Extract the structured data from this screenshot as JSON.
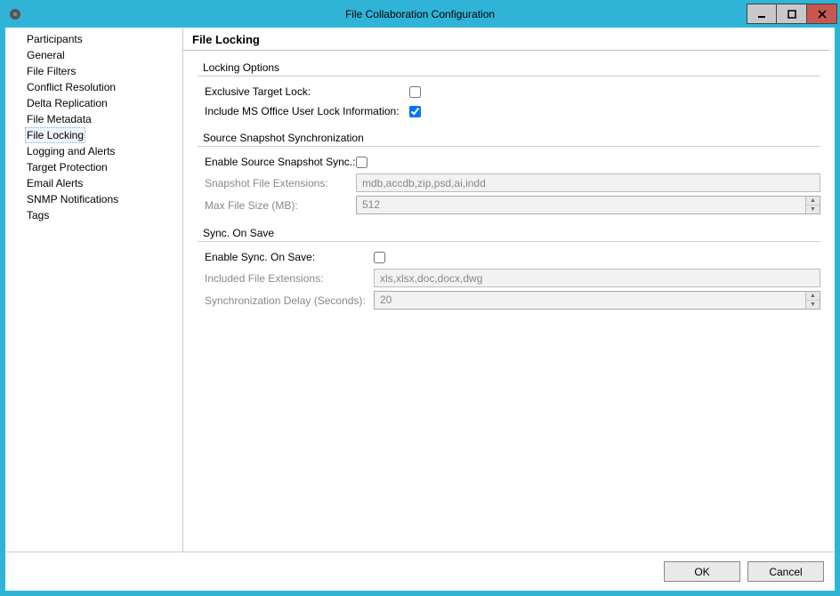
{
  "window": {
    "title": "File Collaboration Configuration"
  },
  "sidebar": {
    "items": [
      {
        "label": "Participants",
        "selected": false
      },
      {
        "label": "General",
        "selected": false
      },
      {
        "label": "File Filters",
        "selected": false
      },
      {
        "label": "Conflict Resolution",
        "selected": false
      },
      {
        "label": "Delta Replication",
        "selected": false
      },
      {
        "label": "File Metadata",
        "selected": false
      },
      {
        "label": "File Locking",
        "selected": true
      },
      {
        "label": "Logging and Alerts",
        "selected": false
      },
      {
        "label": "Target Protection",
        "selected": false
      },
      {
        "label": "Email Alerts",
        "selected": false
      },
      {
        "label": "SNMP Notifications",
        "selected": false
      },
      {
        "label": "Tags",
        "selected": false
      }
    ]
  },
  "page": {
    "title": "File Locking",
    "groups": {
      "locking": {
        "title": "Locking Options",
        "exclusive_label": "Exclusive Target Lock:",
        "exclusive_checked": false,
        "msoffice_label": "Include MS Office User Lock Information:",
        "msoffice_checked": true
      },
      "snapshot": {
        "title": "Source Snapshot Synchronization",
        "enable_label": "Enable Source Snapshot Sync.:",
        "enable_checked": false,
        "ext_label": "Snapshot File Extensions:",
        "ext_value": "mdb,accdb,zip,psd,ai,indd",
        "max_label": "Max File Size (MB):",
        "max_value": "512"
      },
      "syncsave": {
        "title": "Sync. On Save",
        "enable_label": "Enable Sync. On Save:",
        "enable_checked": false,
        "ext_label": "Included File Extensions:",
        "ext_value": "xls,xlsx,doc,docx,dwg",
        "delay_label": "Synchronization Delay (Seconds):",
        "delay_value": "20"
      }
    }
  },
  "footer": {
    "ok": "OK",
    "cancel": "Cancel"
  }
}
